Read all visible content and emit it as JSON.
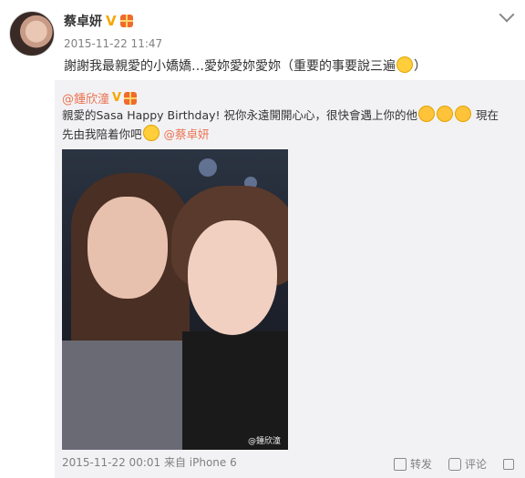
{
  "post": {
    "author_name": "蔡卓妍",
    "verified_badge": "V",
    "timestamp": "2015-11-22 11:47",
    "text": "謝謝我最親愛的小嬌嬌…愛妳愛妳愛妳（重要的事要說三遍",
    "text_end": "）"
  },
  "repost": {
    "author_name": "@鍾欣潼",
    "text_part1": "親愛的Sasa Happy Birthday! 祝你永遠開開心心，很快會遇上你的他",
    "text_part2": " 現在先由我陪着你吧",
    "mention": "@蔡卓妍",
    "watermark": "@鍾欣潼",
    "meta": "2015-11-22 00:01 来自 iPhone 6",
    "actions": {
      "share_label": "转发",
      "comment_label": "评论",
      "like_label": ""
    }
  }
}
